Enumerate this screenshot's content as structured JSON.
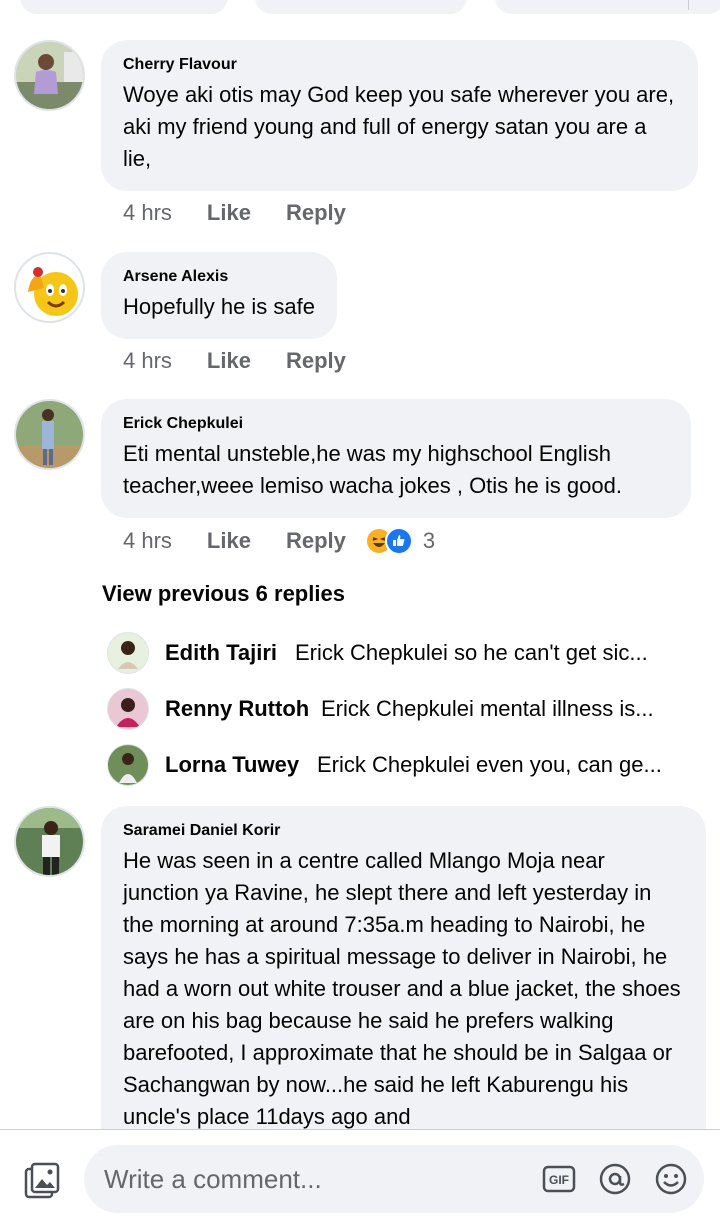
{
  "comments": [
    {
      "author": "Cherry Flavour",
      "text": "Woye aki otis may God keep you safe wherever you are, aki my friend young and full of energy satan you are a lie,",
      "time": "4 hrs",
      "like_label": "Like",
      "reply_label": "Reply"
    },
    {
      "author": "Arsene Alexis",
      "text": "Hopefully he is safe",
      "time": "4 hrs",
      "like_label": "Like",
      "reply_label": "Reply"
    },
    {
      "author": "Erick Chepkulei",
      "text": "Eti mental unsteble,he was my highschool English teacher,weee lemiso wacha jokes , Otis he is good.",
      "time": "4 hrs",
      "like_label": "Like",
      "reply_label": "Reply",
      "reaction_count": "3",
      "reactions": [
        "laugh-icon",
        "like-icon"
      ]
    },
    {
      "author": "Saramei Daniel Korir",
      "text": "He was seen in a centre called Mlango Moja near junction ya Ravine, he slept there and left yesterday in the morning at around 7:35a.m heading to Nairobi, he says he has a spiritual message to deliver in Nairobi, he had a worn out white trouser and a blue jacket, the shoes are on his bag because he said he prefers walking barefooted, I approximate that he should be in Salgaa or Sachangwan by now...he said he left Kaburengu his uncle's place 11days ago and"
    }
  ],
  "view_previous": "View previous 6 replies",
  "replies": [
    {
      "name": "Edith Tajiri",
      "snippet": "Erick Chepkulei so he can't get sic..."
    },
    {
      "name": "Renny Ruttoh",
      "snippet": "Erick Chepkulei mental illness is..."
    },
    {
      "name": "Lorna Tuwey",
      "snippet": "Erick Chepkulei even you, can ge..."
    }
  ],
  "composer": {
    "placeholder": "Write a comment...",
    "icons": [
      "photo-icon",
      "gif-icon",
      "mention-icon",
      "emoji-icon"
    ],
    "gif_label": "GIF"
  },
  "colors": {
    "bubble_bg": "#f0f2f5",
    "meta_gray": "#65676b",
    "like_blue": "#1877f2",
    "laugh_yellow": "#f7b125"
  }
}
